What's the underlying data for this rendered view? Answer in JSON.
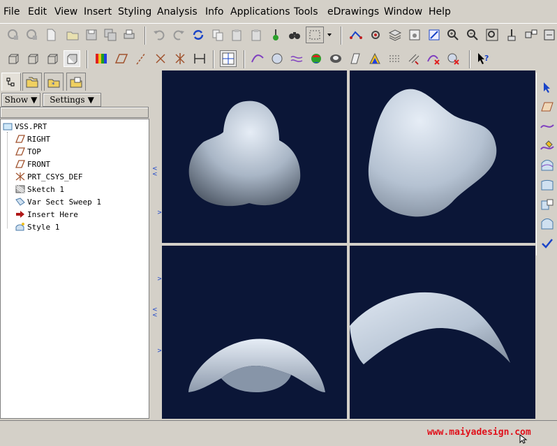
{
  "menu": [
    "File",
    "Edit",
    "View",
    "Insert",
    "Styling",
    "Analysis",
    "Info",
    "Applications",
    "Tools",
    "eDrawings",
    "Window",
    "Help"
  ],
  "panel": {
    "show_label": "Show",
    "settings_label": "Settings"
  },
  "tree": {
    "items": [
      {
        "label": "VSS.PRT",
        "icon": "part-icon"
      },
      {
        "label": "RIGHT",
        "icon": "datum-plane-icon"
      },
      {
        "label": "TOP",
        "icon": "datum-plane-icon"
      },
      {
        "label": "FRONT",
        "icon": "datum-plane-icon"
      },
      {
        "label": "PRT_CSYS_DEF",
        "icon": "csys-icon"
      },
      {
        "label": "Sketch 1",
        "icon": "sketch-icon"
      },
      {
        "label": "Var Sect Sweep 1",
        "icon": "sweep-icon"
      },
      {
        "label": "Insert Here",
        "icon": "insert-arrow-icon"
      },
      {
        "label": "Style 1",
        "icon": "style-icon"
      }
    ]
  },
  "watermark": "www.maiyadesign.com",
  "colors": {
    "viewport_bg": "#0b1637",
    "surface": "#b8c6d6",
    "accent_red": "#e0101a"
  }
}
